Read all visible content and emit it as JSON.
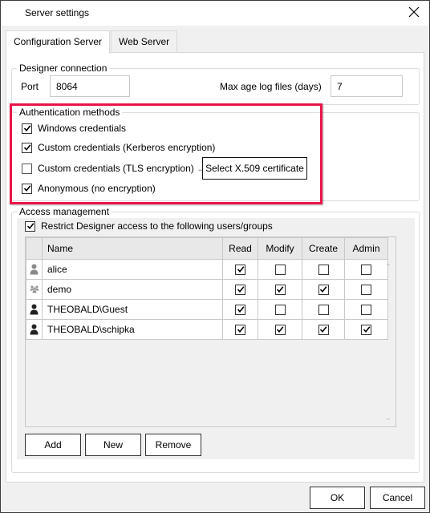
{
  "window": {
    "title": "Server settings",
    "close_icon": "close-icon"
  },
  "tabs": [
    {
      "label": "Configuration Server",
      "active": true
    },
    {
      "label": "Web Server",
      "active": false
    }
  ],
  "designer_connection": {
    "legend": "Designer connection",
    "port_label": "Port",
    "port_value": "8064",
    "max_age_label": "Max age log files (days)",
    "max_age_value": "7"
  },
  "authentication": {
    "legend": "Authentication methods",
    "options": [
      {
        "label": "Windows credentials",
        "checked": true
      },
      {
        "label": "Custom credentials (Kerberos encryption)",
        "checked": true
      },
      {
        "label": "Custom credentials (TLS encryption) →",
        "checked": false
      },
      {
        "label": "Anonymous (no encryption)",
        "checked": true
      }
    ],
    "certificate_button": "Select X.509 certificate",
    "highlight_color": "#e8154a"
  },
  "access_management": {
    "legend": "Access management",
    "restrict_label": "Restrict Designer access to the following users/groups",
    "restrict_checked": true,
    "columns": [
      "",
      "Name",
      "Read",
      "Modify",
      "Create",
      "Admin"
    ],
    "rows": [
      {
        "icon": "user-icon-gray",
        "name": "alice",
        "read": true,
        "modify": false,
        "create": false,
        "admin": false
      },
      {
        "icon": "group-icon",
        "name": "demo",
        "read": true,
        "modify": true,
        "create": true,
        "admin": false
      },
      {
        "icon": "user-icon",
        "name": "THEOBALD\\Guest",
        "read": true,
        "modify": false,
        "create": false,
        "admin": false
      },
      {
        "icon": "user-icon",
        "name": "THEOBALD\\schipka",
        "read": true,
        "modify": true,
        "create": true,
        "admin": true
      }
    ],
    "buttons": {
      "add": "Add",
      "new": "New",
      "remove": "Remove"
    }
  },
  "footer": {
    "ok": "OK",
    "cancel": "Cancel"
  }
}
